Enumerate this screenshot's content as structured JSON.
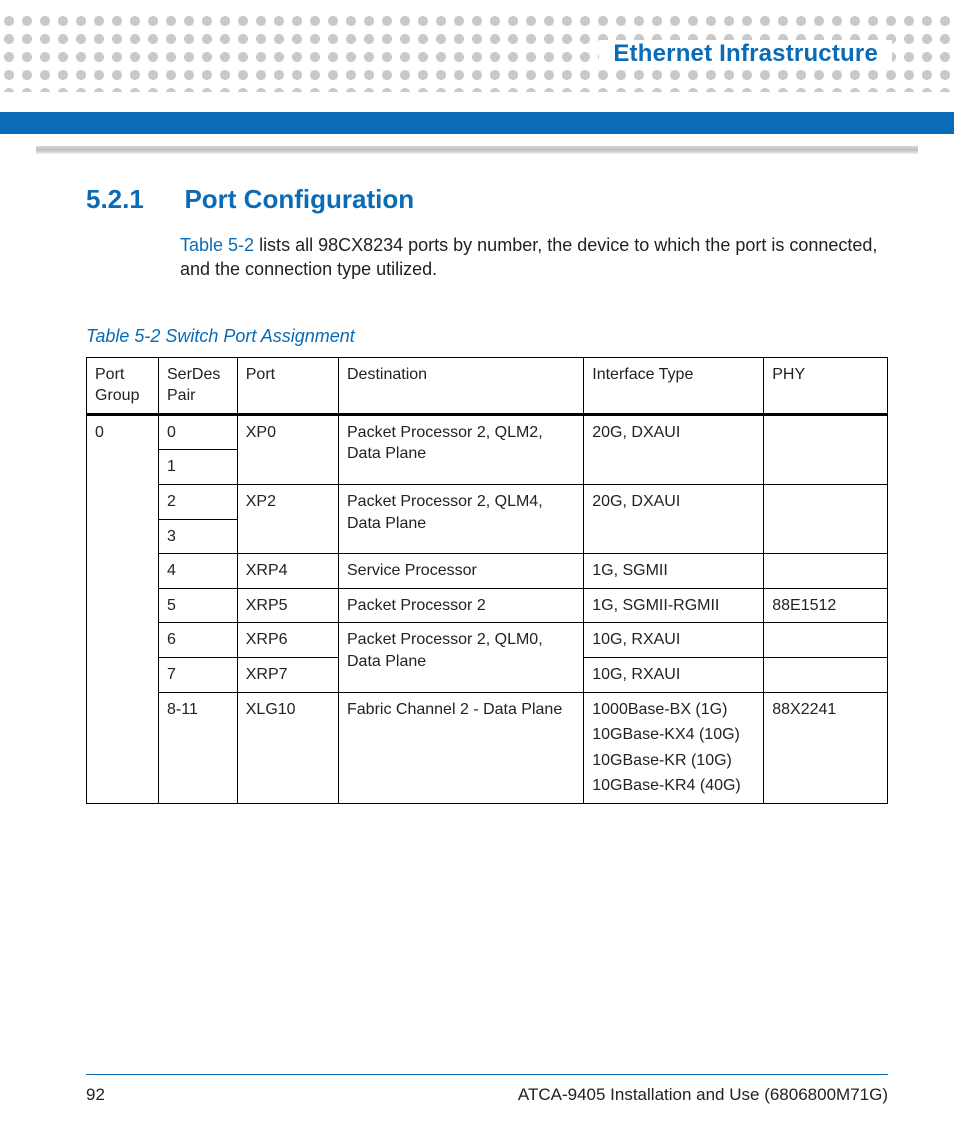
{
  "header": {
    "chapter_title": "Ethernet Infrastructure"
  },
  "section": {
    "number": "5.2.1",
    "title": "Port Configuration",
    "link_text": "Table 5-2",
    "body_rest": " lists all 98CX8234 ports by number, the device to which the port is connected, and the connection type utilized."
  },
  "table": {
    "caption": "Table 5-2 Switch Port Assignment",
    "headers": {
      "port_group": "Port Group",
      "serdes_pair": "SerDes Pair",
      "port": "Port",
      "destination": "Destination",
      "interface_type": "Interface Type",
      "phy": "PHY"
    },
    "port_group": "0",
    "rows": {
      "r0": {
        "serdes": "0",
        "port": "XP0",
        "dest": "Packet Processor 2, QLM2, Data Plane",
        "if": "20G, DXAUI",
        "phy": ""
      },
      "r1": {
        "serdes": "1"
      },
      "r2": {
        "serdes": "2",
        "port": "XP2",
        "dest": "Packet Processor 2, QLM4, Data Plane",
        "if": "20G, DXAUI",
        "phy": ""
      },
      "r3": {
        "serdes": "3"
      },
      "r4": {
        "serdes": "4",
        "port": "XRP4",
        "dest": "Service Processor",
        "if": "1G, SGMII",
        "phy": ""
      },
      "r5": {
        "serdes": "5",
        "port": "XRP5",
        "dest": "Packet Processor 2",
        "if": "1G, SGMII-RGMII",
        "phy": "88E1512"
      },
      "r6": {
        "serdes": "6",
        "port": "XRP6",
        "dest": "Packet Processor 2, QLM0, Data Plane",
        "if": "10G, RXAUI",
        "phy": ""
      },
      "r7": {
        "serdes": "7",
        "port": "XRP7",
        "if": "10G, RXAUI",
        "phy": ""
      },
      "r8": {
        "serdes": "8-11",
        "port": "XLG10",
        "dest": "Fabric Channel 2 - Data Plane",
        "if_lines": {
          "l0": "1000Base-BX (1G)",
          "l1": "10GBase-KX4 (10G)",
          "l2": "10GBase-KR (10G)",
          "l3": "10GBase-KR4 (40G)"
        },
        "phy": "88X2241"
      }
    }
  },
  "footer": {
    "page_number": "92",
    "doc_title": "ATCA-9405 Installation and Use (6806800M71G)"
  }
}
